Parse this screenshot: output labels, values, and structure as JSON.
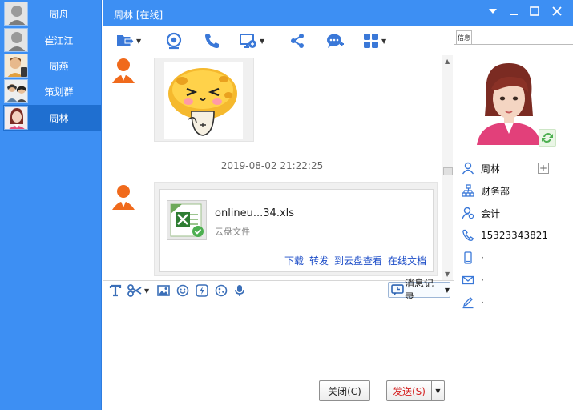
{
  "contacts": [
    {
      "name": "周舟",
      "active": false
    },
    {
      "name": "崔江江",
      "active": false
    },
    {
      "name": "周燕",
      "active": false
    },
    {
      "name": "策划群",
      "active": false
    },
    {
      "name": "周林",
      "active": true
    }
  ],
  "window": {
    "title": "周林 [在线]",
    "controls": [
      "chevron-down-icon",
      "minimize-icon",
      "maximize-icon",
      "close-icon"
    ]
  },
  "toolbar": {
    "items": [
      "send-file-icon",
      "video-call-icon",
      "voice-call-icon",
      "remote-desktop-icon",
      "share-icon",
      "new-message-icon",
      "apps-icon"
    ]
  },
  "chat": {
    "timestamp": "2019-08-02 21:22:25",
    "file": {
      "name": "onlineu...34.xls",
      "type": "云盘文件",
      "actions": [
        "下载",
        "转发",
        "到云盘查看",
        "在线文档"
      ]
    }
  },
  "input_toolbar": {
    "items": [
      "font-icon",
      "scissors-icon",
      "image-icon",
      "emoji-icon",
      "flash-icon",
      "sticker-icon",
      "microphone-icon"
    ],
    "history_label": "消息记录"
  },
  "buttons": {
    "close_label": "关闭(C)",
    "send_label": "发送(S)"
  },
  "profile": {
    "tab_label": "信息",
    "name": "周林",
    "department": "财务部",
    "role": "会计",
    "phone": "15323343821",
    "device": "·",
    "email": "·",
    "signature": "·"
  },
  "colors": {
    "accent": "#3d8ff3",
    "active_contact": "#1f6fd0",
    "send_text": "#d42222",
    "link": "#1e4ec8"
  }
}
